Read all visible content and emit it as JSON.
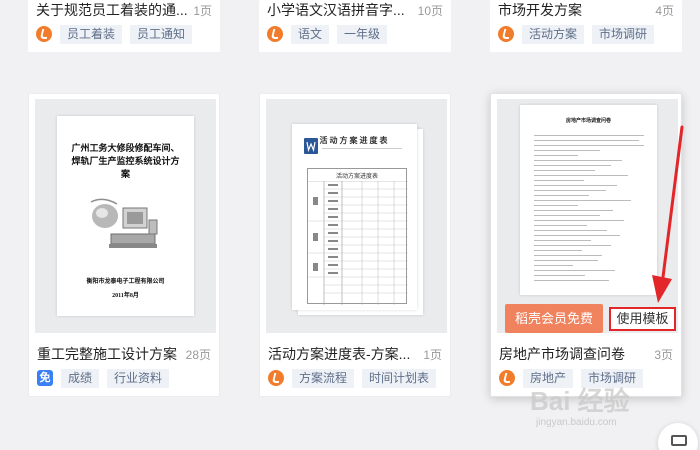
{
  "top_cards": [
    {
      "title": "关于规范员工着装的通...",
      "pages": "1页",
      "icon": "doc-icon",
      "tags": [
        "员工着装",
        "员工通知"
      ]
    },
    {
      "title": "小学语文汉语拼音字...",
      "pages": "10页",
      "icon": "doc-icon",
      "tags": [
        "语文",
        "一年级"
      ]
    },
    {
      "title": "市场开发方案",
      "pages": "4页",
      "icon": "doc-icon",
      "tags": [
        "活动方案",
        "市场调研"
      ]
    }
  ],
  "cards": [
    {
      "title": "重工完整施工设计方案",
      "pages": "28页",
      "icon": "m-icon",
      "icon_text": "免",
      "tags": [
        "成绩",
        "行业资料"
      ],
      "preview": {
        "cover_title": "广州工务大修段修配车间、焊轨厂生产监控系统设计方案",
        "company": "衡阳市龙泰电子工程有限公司",
        "date": "2011年8月"
      }
    },
    {
      "title": "活动方案进度表-方案...",
      "pages": "1页",
      "icon": "doc-icon",
      "tags": [
        "方案流程",
        "时间计划表"
      ],
      "preview": {
        "sheet_title": "活动方案进度表",
        "table_title": "活动方案进度表"
      }
    },
    {
      "title": "房地产市场调查问卷",
      "pages": "3页",
      "icon": "doc-icon",
      "tags": [
        "房地产",
        "市场调研"
      ],
      "preview": {
        "doc_title": "房地产市场调查问卷"
      },
      "actions": {
        "vip_label": "稻壳会员免费",
        "use_label": "使用模板"
      }
    }
  ],
  "colors": {
    "accent_orange": "#f07c2c",
    "vip_button": "#f0825e",
    "highlight_red": "#e2262a",
    "free_badge": "#3b7ff5"
  },
  "watermark": {
    "text": "Bai 经验",
    "sub": "jingyan.baidu.com"
  }
}
